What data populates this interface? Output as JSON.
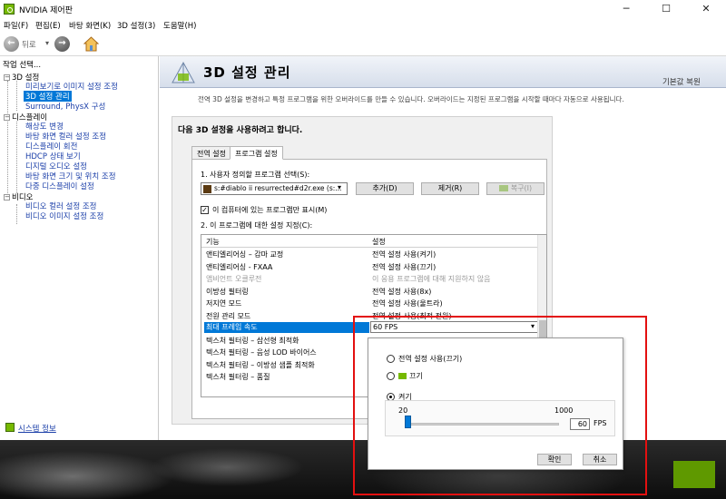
{
  "window": {
    "title": "NVIDIA 제어판",
    "minimize": "─",
    "maximize": "☐",
    "close": "✕"
  },
  "menu": [
    "파일(F)",
    "편집(E)",
    "바탕 화면(K)",
    "3D 설정(3)",
    "도움말(H)"
  ],
  "toolbar": {
    "back_label": "뒤로",
    "back_arrow": "←",
    "forward_arrow": "→",
    "dropdown_arrow": "▾"
  },
  "sidebar": {
    "header": "작업 선택...",
    "categories": [
      {
        "label": "3D 설정",
        "toggle": "−",
        "items": [
          "미리보기로 이미지 설정 조정",
          "3D 설정 관리",
          "Surround, PhysX 구성"
        ]
      },
      {
        "label": "디스플레이",
        "toggle": "−",
        "items": [
          "해상도 변경",
          "바탕 화면 컬러 설정 조정",
          "디스플레이 회전",
          "HDCP 상태 보기",
          "디지털 오디오 설정",
          "바탕 화면 크기 및 위치 조정",
          "다중 디스플레이 설정"
        ]
      },
      {
        "label": "비디오",
        "toggle": "−",
        "items": [
          "비디오 컬러 설정 조정",
          "비디오 이미지 설정 조정"
        ]
      }
    ],
    "selected": "3D 설정 관리",
    "system_info": "시스템 정보"
  },
  "page": {
    "title": "3D 설정 관리",
    "restore_defaults": "기본값 복원",
    "description": "전역 3D 설정을 변경하고 특정 프로그램을 위한 오버라이드를 만들 수 있습니다. 오버라이드는 지정된 프로그램을 시작할 때마다 자동으로 사용됩니다.",
    "settings_heading": "다음 3D 설정을 사용하려고 합니다.",
    "tabs": [
      "전역 설정",
      "프로그램 설정"
    ],
    "active_tab": "프로그램 설정",
    "step1_label": "1. 사용자 정의할 프로그램 선택(S):",
    "program_selected": "s:#diablo ii resurrected#d2r.exe (s:...",
    "select_arrow": "▾",
    "add_button": "추가(D)",
    "remove_button": "제거(R)",
    "restore_button": "복구(I)",
    "show_only_label": "이 컴퓨터에 있는 프로그램만 표시(M)",
    "show_only_checked": true,
    "check_glyph": "✓",
    "step2_label": "2. 이 프로그램에 대한 설정 지정(C):",
    "table": {
      "headers": [
        "기능",
        "설정"
      ],
      "rows": [
        {
          "feature": "앤티엘리어싱 – 감마 교정",
          "value": "전역 설정 사용(켜기)"
        },
        {
          "feature": "앤티엘리어싱 - FXAA",
          "value": "전역 설정 사용(끄기)"
        },
        {
          "feature": "앰비언트 오클루전",
          "value": "이 응용 프로그램에 대해 지원하지 않음",
          "dim": true
        },
        {
          "feature": "이방성 필터링",
          "value": "전역 설정 사용(8x)"
        },
        {
          "feature": "저지연 모드",
          "value": "전역 설정 사용(울트라)"
        },
        {
          "feature": "전원 관리 모드",
          "value": "전역 설정 사용(최적 전원)"
        },
        {
          "feature": "최대 프레임 속도",
          "value": "60 FPS",
          "selected": true
        },
        {
          "feature": "텍스처 필터링 – 삼선형 최적화",
          "value": ""
        },
        {
          "feature": "텍스처 필터링 – 음성 LOD 바이어스",
          "value": ""
        },
        {
          "feature": "텍스처 필터링 – 이방성 샘플 최적화",
          "value": ""
        },
        {
          "feature": "텍스처 필터링 – 품질",
          "value": ""
        }
      ]
    }
  },
  "popup": {
    "option_global": "전역 설정 사용(끄기)",
    "option_off": "끄기",
    "option_on": "켜기",
    "selected_option": "켜기",
    "slider_min": "20",
    "slider_max": "1000",
    "slider_value": 60,
    "fps_value": "60",
    "fps_unit": "FPS",
    "ok_button": "확인",
    "cancel_button": "취소"
  },
  "colors": {
    "accent": "#0078d7",
    "nvidia_green": "#76b900",
    "highlight_frame": "#e31010",
    "link": "#1a3ea8"
  }
}
